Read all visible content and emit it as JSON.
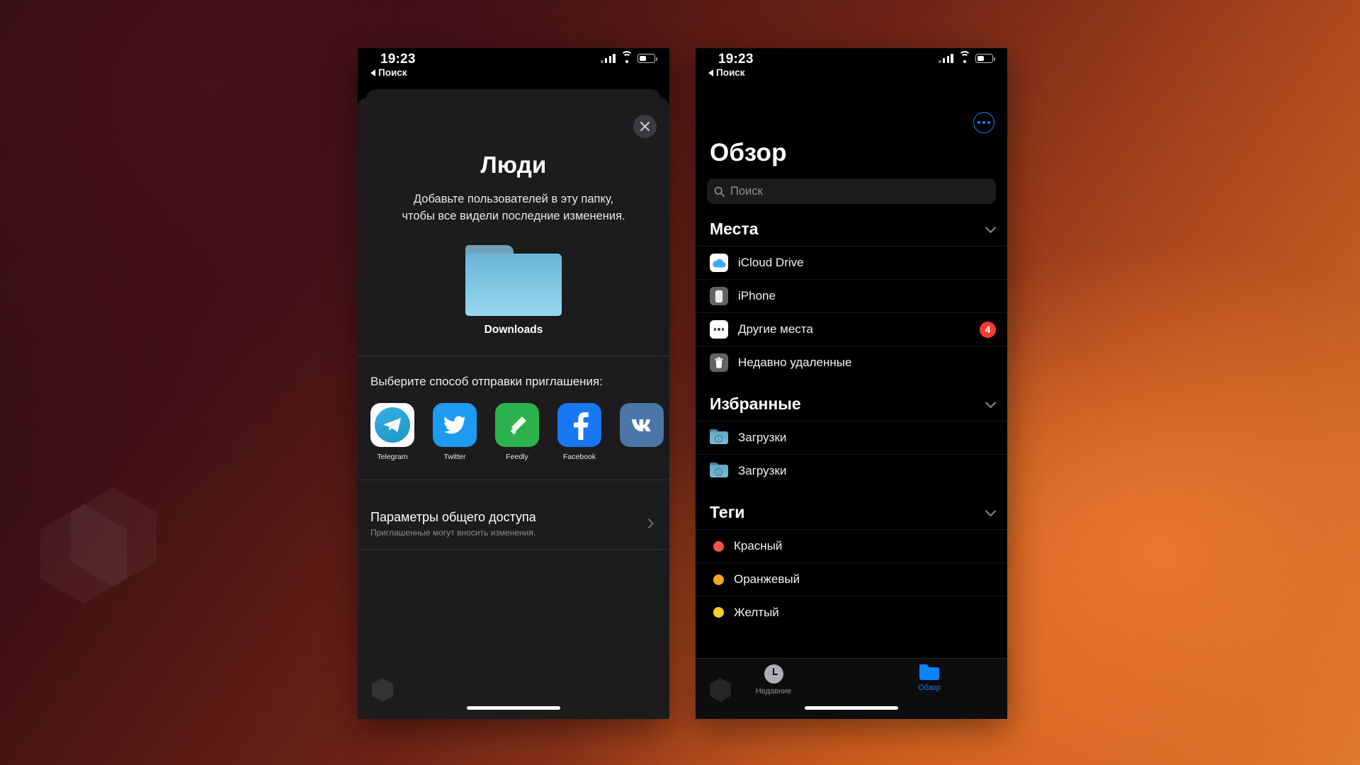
{
  "background": {
    "accent_start": "#2a0b11",
    "accent_end": "#e07c2c"
  },
  "watermark": {
    "shape": "hexagon"
  },
  "status_bar": {
    "time": "19:23",
    "back_label": "Поиск",
    "icons": [
      "signal-bars-icon",
      "wifi-icon",
      "battery-icon"
    ]
  },
  "left_phone": {
    "share_sheet": {
      "close_icon": "close-icon",
      "title": "Люди",
      "subtitle": "Добавьте пользователей в эту папку, чтобы все видели последние изменения.",
      "folder": {
        "icon": "folder-icon",
        "label": "Downloads"
      },
      "share_prompt": "Выберите способ отправки приглашения:",
      "apps": [
        {
          "label": "Telegram",
          "icon": "telegram-icon",
          "color": "#1e96c8"
        },
        {
          "label": "Twitter",
          "icon": "twitter-icon",
          "color": "#1d9bf0"
        },
        {
          "label": "Feedly",
          "icon": "feedly-icon",
          "color": "#2bb24c"
        },
        {
          "label": "Facebook",
          "icon": "facebook-icon",
          "color": "#1877f2"
        },
        {
          "label": "",
          "icon": "vk-icon",
          "color": "#4a76a8"
        }
      ],
      "options": {
        "title": "Параметры общего доступа",
        "subtitle": "Приглашенные могут вносить изменения.",
        "chevron": "chevron-right-icon"
      }
    }
  },
  "right_phone": {
    "more_button": "more-ellipsis-icon",
    "title": "Обзор",
    "search": {
      "placeholder": "Поиск",
      "icon": "search-icon"
    },
    "sections": [
      {
        "title": "Места",
        "collapse_icon": "chevron-down-icon",
        "items": [
          {
            "label": "iCloud Drive",
            "icon": "icloud-icon",
            "badge": ""
          },
          {
            "label": "iPhone",
            "icon": "iphone-icon",
            "badge": ""
          },
          {
            "label": "Другие места",
            "icon": "ellipsis-icon",
            "badge": "4"
          },
          {
            "label": "Недавно удаленные",
            "icon": "trash-icon",
            "badge": ""
          }
        ]
      },
      {
        "title": "Избранные",
        "collapse_icon": "chevron-down-icon",
        "items": [
          {
            "label": "Загрузки",
            "icon": "downloads-folder-icon",
            "badge": ""
          },
          {
            "label": "Загрузки",
            "icon": "downloads-folder-icon",
            "badge": ""
          }
        ]
      },
      {
        "title": "Теги",
        "collapse_icon": "chevron-down-icon",
        "items": [
          {
            "label": "Красный",
            "icon": "tag-dot-icon",
            "color": "#f4524d",
            "badge": ""
          },
          {
            "label": "Оранжевый",
            "icon": "tag-dot-icon",
            "color": "#f5a623",
            "badge": ""
          },
          {
            "label": "Желтый",
            "icon": "tag-dot-icon",
            "color": "#f2d02c",
            "badge": ""
          }
        ]
      }
    ],
    "tabbar": [
      {
        "label": "Недавние",
        "icon": "recents-clock-icon",
        "active": false
      },
      {
        "label": "Обзор",
        "icon": "browse-folder-icon",
        "active": true
      }
    ]
  },
  "badge_color": "#ff3b30",
  "accent_blue": "#0a84ff"
}
